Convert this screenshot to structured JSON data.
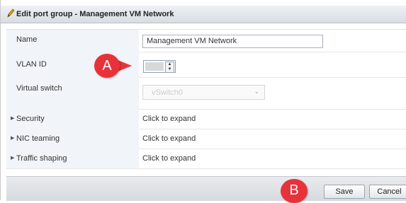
{
  "dialog": {
    "title": "Edit port group - Management VM Network",
    "title_icon": "pencil-icon"
  },
  "form": {
    "name": {
      "label": "Name",
      "value": "Management VM Network"
    },
    "vlan": {
      "label": "VLAN ID",
      "value": ""
    },
    "vswitch": {
      "label": "Virtual switch",
      "value": "vSwitch0"
    },
    "security": {
      "label": "Security",
      "value": "Click to expand"
    },
    "nic_teaming": {
      "label": "NIC teaming",
      "value": "Click to expand"
    },
    "traffic_shaping": {
      "label": "Traffic shaping",
      "value": "Click to expand"
    }
  },
  "footer": {
    "save_label": "Save",
    "cancel_label": "Cancel"
  },
  "callouts": {
    "a_label": "A",
    "b_label": "B",
    "color": "#e8323a"
  }
}
